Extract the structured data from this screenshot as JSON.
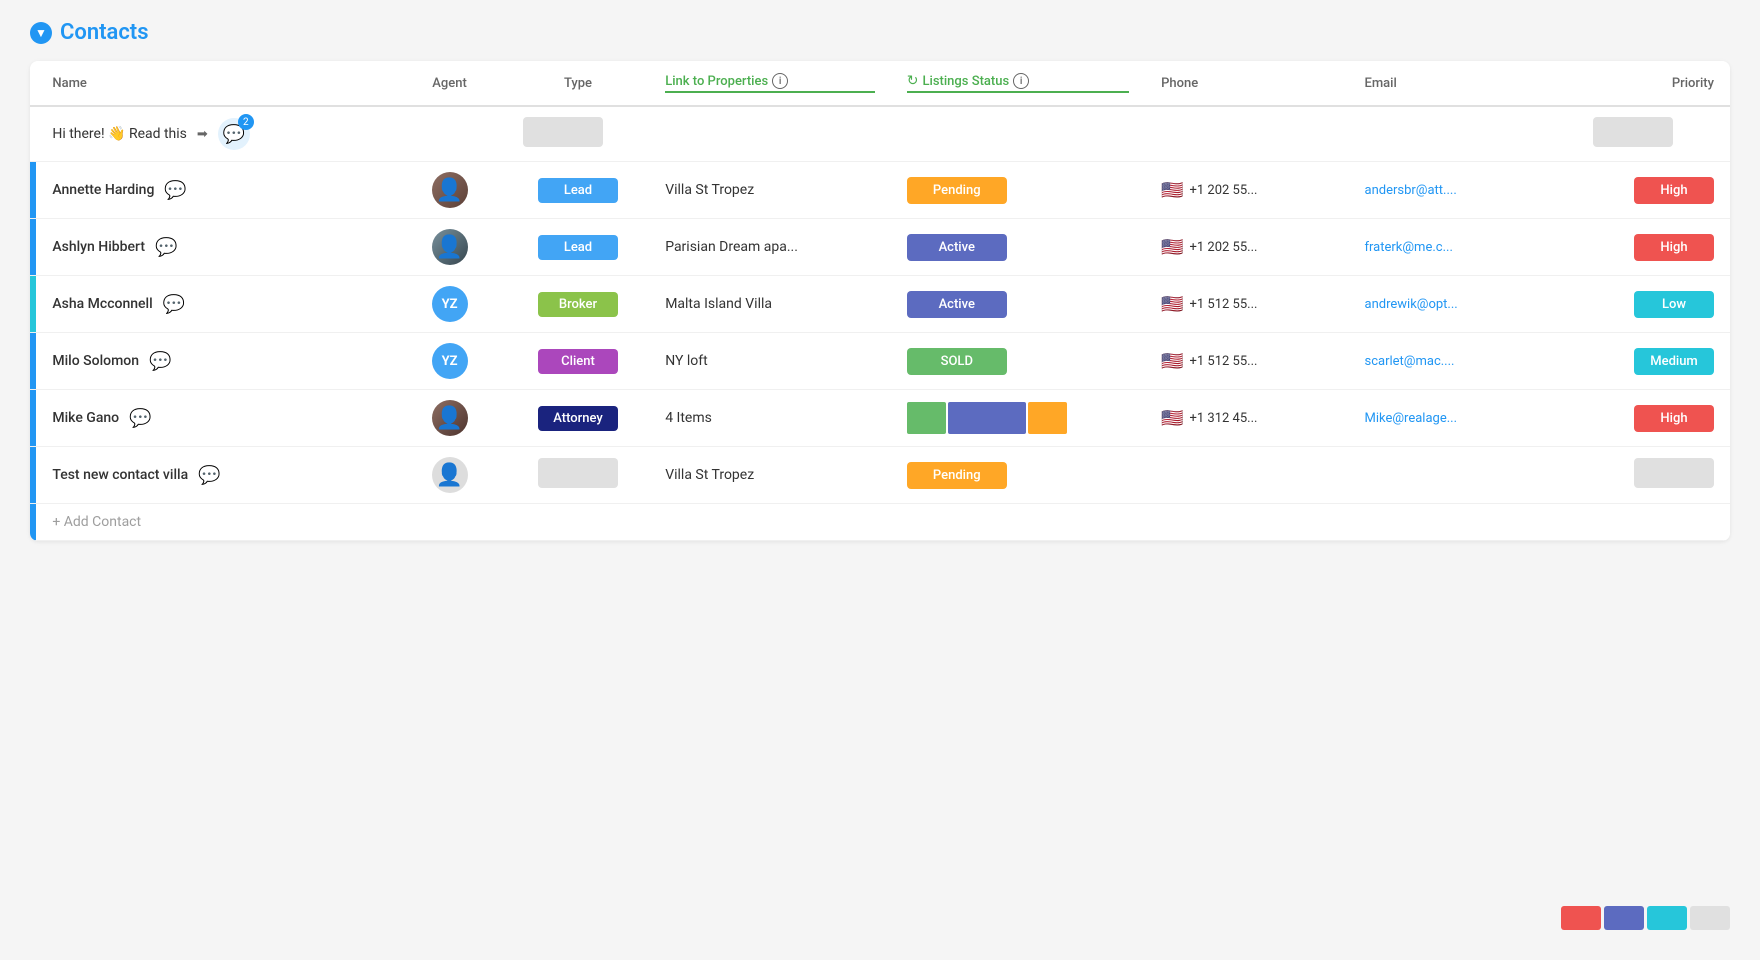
{
  "page": {
    "title": "Contacts",
    "title_icon": "▼"
  },
  "columns": {
    "name": "Name",
    "agent": "Agent",
    "type": "Type",
    "link": "Link to Properties",
    "status": "Listings Status",
    "phone": "Phone",
    "email": "Email",
    "priority": "Priority"
  },
  "notification": {
    "text": "Hi there! 👋 Read this",
    "badge": "2",
    "arrow": "➡"
  },
  "contacts": [
    {
      "id": 1,
      "name": "Annette Harding",
      "agent_type": "photo",
      "agent_initials": "",
      "type": "Lead",
      "type_class": "type-lead",
      "property": "Villa St Tropez",
      "status": "Pending",
      "status_class": "status-pending",
      "phone": "+1 202 55...",
      "email": "andersbr@att....",
      "priority": "High",
      "priority_class": "priority-high",
      "accent": "accent-blue"
    },
    {
      "id": 2,
      "name": "Ashlyn Hibbert",
      "agent_type": "photo2",
      "agent_initials": "",
      "type": "Lead",
      "type_class": "type-lead",
      "property": "Parisian Dream apa...",
      "status": "Active",
      "status_class": "status-active",
      "phone": "+1 202 55...",
      "email": "fraterk@me.c...",
      "priority": "High",
      "priority_class": "priority-high",
      "accent": "accent-blue"
    },
    {
      "id": 3,
      "name": "Asha Mcconnell",
      "agent_type": "initials",
      "agent_initials": "YZ",
      "type": "Broker",
      "type_class": "type-broker",
      "property": "Malta Island Villa",
      "status": "Active",
      "status_class": "status-active",
      "phone": "+1 512 55...",
      "email": "andrewik@opt...",
      "priority": "Low",
      "priority_class": "priority-low",
      "accent": "accent-teal"
    },
    {
      "id": 4,
      "name": "Milo Solomon",
      "agent_type": "initials",
      "agent_initials": "YZ",
      "type": "Client",
      "type_class": "type-client",
      "property": "NY loft",
      "status": "SOLD",
      "status_class": "status-sold",
      "phone": "+1 512 55...",
      "email": "scarlet@mac....",
      "priority": "Medium",
      "priority_class": "priority-medium",
      "accent": "accent-blue"
    },
    {
      "id": 5,
      "name": "Mike Gano",
      "agent_type": "photo3",
      "agent_initials": "",
      "type": "Attorney",
      "type_class": "type-attorney",
      "property": "4 Items",
      "status": "multi",
      "status_class": "",
      "phone": "+1 312 45...",
      "email": "Mike@realage...",
      "priority": "High",
      "priority_class": "priority-high",
      "accent": "accent-blue"
    },
    {
      "id": 6,
      "name": "Test new contact villa",
      "agent_type": "placeholder",
      "agent_initials": "",
      "type": "",
      "type_class": "",
      "property": "Villa St Tropez",
      "status": "Pending",
      "status_class": "status-pending",
      "phone": "",
      "email": "",
      "priority": "",
      "priority_class": "",
      "accent": "accent-blue"
    }
  ],
  "add_contact_label": "+ Add Contact",
  "legend": {
    "colors": [
      "#EF5350",
      "#5C6BC0",
      "#26C6DA",
      "#e0e0e0"
    ]
  }
}
